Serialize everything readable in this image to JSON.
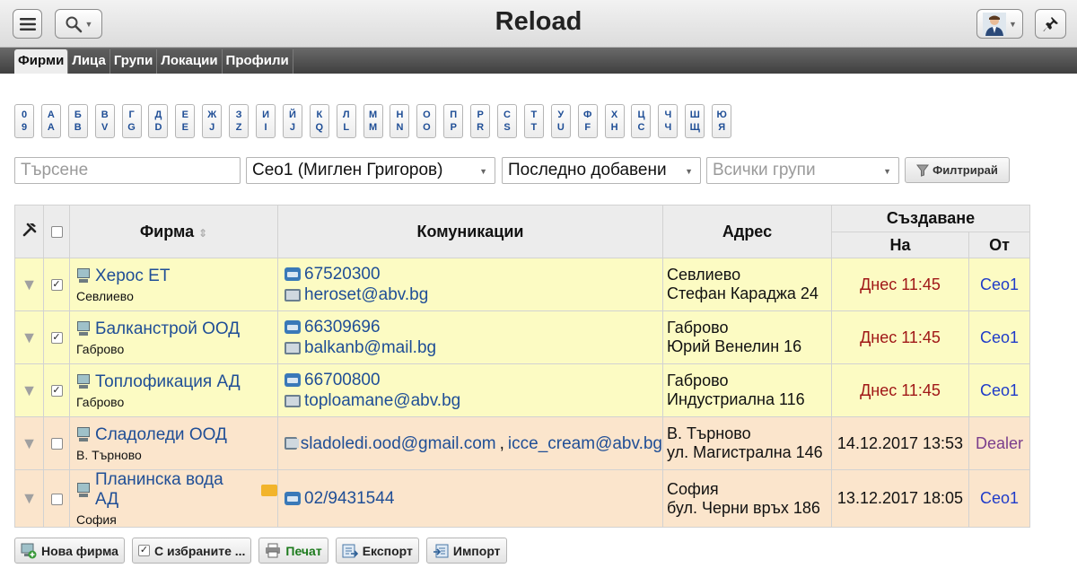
{
  "header": {
    "title": "Reload",
    "menu_icon": "hamburger-menu-icon",
    "search_icon": "magnifier-icon",
    "user_icon": "user-avatar-icon",
    "pin_icon": "pin-icon"
  },
  "tabs": [
    {
      "label": "Фирми",
      "active": true
    },
    {
      "label": "Лица",
      "active": false
    },
    {
      "label": "Групи",
      "active": false
    },
    {
      "label": "Локации",
      "active": false
    },
    {
      "label": "Профили",
      "active": false
    }
  ],
  "alphabet": [
    {
      "top": "0",
      "bottom": "9"
    },
    {
      "top": "А",
      "bottom": "A"
    },
    {
      "top": "Б",
      "bottom": "B"
    },
    {
      "top": "В",
      "bottom": "V"
    },
    {
      "top": "Г",
      "bottom": "G"
    },
    {
      "top": "Д",
      "bottom": "D"
    },
    {
      "top": "Е",
      "bottom": "E"
    },
    {
      "top": "Ж",
      "bottom": "J"
    },
    {
      "top": "З",
      "bottom": "Z"
    },
    {
      "top": "И",
      "bottom": "I"
    },
    {
      "top": "Й",
      "bottom": "J"
    },
    {
      "top": "К",
      "bottom": "Q"
    },
    {
      "top": "Л",
      "bottom": "L"
    },
    {
      "top": "М",
      "bottom": "M"
    },
    {
      "top": "Н",
      "bottom": "N"
    },
    {
      "top": "О",
      "bottom": "O"
    },
    {
      "top": "П",
      "bottom": "P"
    },
    {
      "top": "Р",
      "bottom": "R"
    },
    {
      "top": "С",
      "bottom": "S"
    },
    {
      "top": "Т",
      "bottom": "T"
    },
    {
      "top": "У",
      "bottom": "U"
    },
    {
      "top": "Ф",
      "bottom": "F"
    },
    {
      "top": "Х",
      "bottom": "H"
    },
    {
      "top": "Ц",
      "bottom": "C"
    },
    {
      "top": "Ч",
      "bottom": "Ч"
    },
    {
      "top": "Ш",
      "bottom": "Щ"
    },
    {
      "top": "Ю",
      "bottom": "Я"
    }
  ],
  "filters": {
    "search_placeholder": "Търсене",
    "user_value": "Сео1 (Миглен Григоров)",
    "order_value": "Последно добавени",
    "group_placeholder": "Всички групи",
    "filter_button": "Филтрирай"
  },
  "table": {
    "col_tools_icon": "tools-icon",
    "col_firm": "Фирма",
    "col_comm": "Комуникации",
    "col_address": "Адрес",
    "col_created": "Създаване",
    "col_on": "На",
    "col_by": "От",
    "rows": [
      {
        "checked": true,
        "tone": "yellow",
        "name": "Херос ЕТ",
        "city": "Севлиево",
        "folder": false,
        "phone": "67520300",
        "emails": [
          "heroset@abv.bg"
        ],
        "addr_city": "Севлиево",
        "addr_street": "Стефан Караджа 24",
        "date": "Днес 11:45",
        "date_today": true,
        "by": "Сео1",
        "by_color": "blue"
      },
      {
        "checked": true,
        "tone": "yellow",
        "name": "Балканстрой ООД",
        "city": "Габрово",
        "folder": false,
        "phone": "66309696",
        "emails": [
          "balkanb@mail.bg"
        ],
        "addr_city": "Габрово",
        "addr_street": "Юрий Венелин 16",
        "date": "Днес 11:45",
        "date_today": true,
        "by": "Сео1",
        "by_color": "blue"
      },
      {
        "checked": true,
        "tone": "yellow",
        "name": "Топлофикация АД",
        "city": "Габрово",
        "folder": false,
        "phone": "66700800",
        "emails": [
          "toploamane@abv.bg"
        ],
        "addr_city": "Габрово",
        "addr_street": "Индустриална 116",
        "date": "Днес 11:45",
        "date_today": true,
        "by": "Сео1",
        "by_color": "blue"
      },
      {
        "checked": false,
        "tone": "orange",
        "name": "Сладоледи ООД",
        "city": "В. Търново",
        "folder": false,
        "phone": "",
        "emails": [
          "sladoledi.ood@gmail.com",
          "icce_cream@abv.bg"
        ],
        "addr_city": "В. Търново",
        "addr_street": "ул. Магистрална 146",
        "date": "14.12.2017 13:53",
        "date_today": false,
        "by": "Dealer",
        "by_color": "purple"
      },
      {
        "checked": false,
        "tone": "orange",
        "name": "Планинска вода АД",
        "city": "София",
        "folder": true,
        "phone": "02/9431544",
        "emails": [],
        "addr_city": "София",
        "addr_street": "бул. Черни връх 186",
        "date": "13.12.2017 18:05",
        "date_today": false,
        "by": "Сео1",
        "by_color": "blue"
      }
    ]
  },
  "bottom_buttons": {
    "new_firm": "Нова фирма",
    "with_selected": "С избраните ...",
    "print": "Печат",
    "export": "Експорт",
    "import": "Импорт"
  },
  "colors": {
    "row_yellow": "#fcfbc3",
    "row_orange": "#fbe5cc",
    "link_blue": "#1f4e96",
    "today_red": "#a01717",
    "user_blue": "#1f3bc9",
    "dealer_purple": "#7a3d8c"
  }
}
